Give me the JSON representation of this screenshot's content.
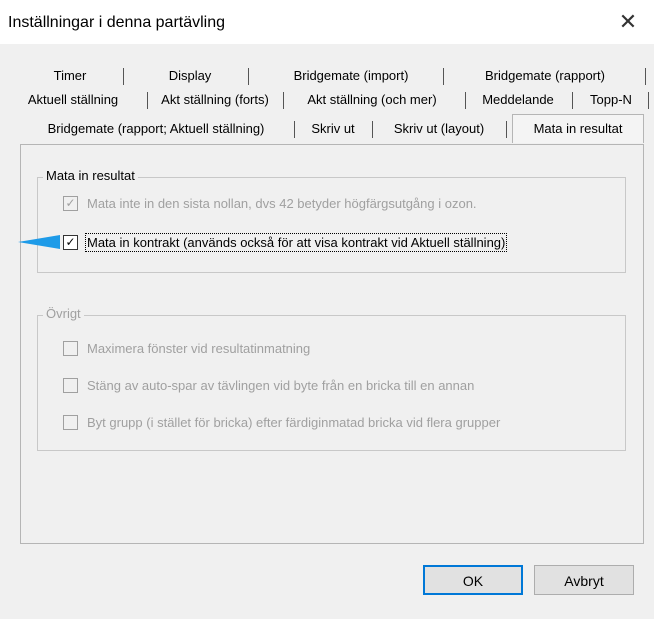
{
  "window": {
    "title": "Inställningar i denna partävling",
    "close_glyph": "✕"
  },
  "tabs": {
    "row1": [
      "Timer",
      "Display",
      "Bridgemate (import)",
      "Bridgemate (rapport)"
    ],
    "row2": [
      "Aktuell ställning",
      "Akt ställning (forts)",
      "Akt ställning (och mer)",
      "Meddelande",
      "Topp-N"
    ],
    "row3": [
      "Bridgemate (rapport; Aktuell ställning)",
      "Skriv ut",
      "Skriv ut (layout)",
      "Mata in resultat"
    ],
    "active": "Mata in resultat"
  },
  "group_mata": {
    "legend": "Mata in resultat",
    "items": [
      {
        "label": "Mata inte in den sista nollan, dvs 42 betyder högfärgsutgång i ozon.",
        "checked": true,
        "disabled": true
      },
      {
        "label": "Mata in kontrakt (används också för att visa kontrakt vid Aktuell ställning)",
        "checked": true,
        "disabled": false
      }
    ]
  },
  "group_ovrigt": {
    "legend": "Övrigt",
    "items": [
      {
        "label": "Maximera fönster vid resultatinmatning",
        "checked": false,
        "disabled": true
      },
      {
        "label": "Stäng av auto-spar av tävlingen vid byte från en bricka till en annan",
        "checked": false,
        "disabled": true
      },
      {
        "label": "Byt grupp (i stället för bricka) efter färdiginmatad bricka vid flera grupper",
        "checked": false,
        "disabled": true
      }
    ]
  },
  "buttons": {
    "ok": "OK",
    "cancel": "Avbryt"
  },
  "check_glyph": "✓",
  "colors": {
    "arrow": "#1e9be8",
    "focus_border": "#0078d7"
  }
}
